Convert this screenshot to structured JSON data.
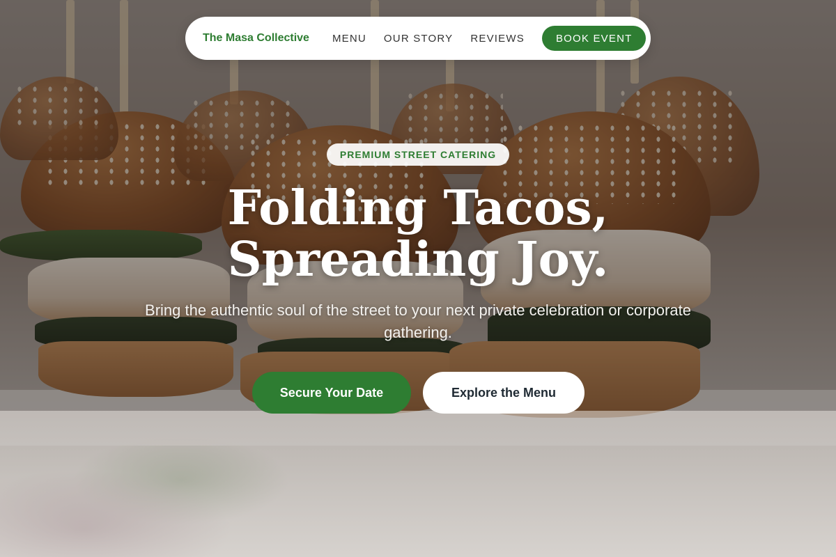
{
  "nav": {
    "brand": "The Masa Collective",
    "links": [
      "MENU",
      "OUR STORY",
      "REVIEWS"
    ],
    "cta": "BOOK EVENT"
  },
  "hero": {
    "badge": "PREMIUM STREET CATERING",
    "headline": "Folding Tacos, Spreading Joy.",
    "subtitle": "Bring the authentic soul of the street to your next private celebration or corporate gathering.",
    "primary_button": "Secure Your Date",
    "secondary_button": "Explore the Menu"
  },
  "colors": {
    "brand_green": "#2e7d32",
    "white": "#ffffff"
  }
}
